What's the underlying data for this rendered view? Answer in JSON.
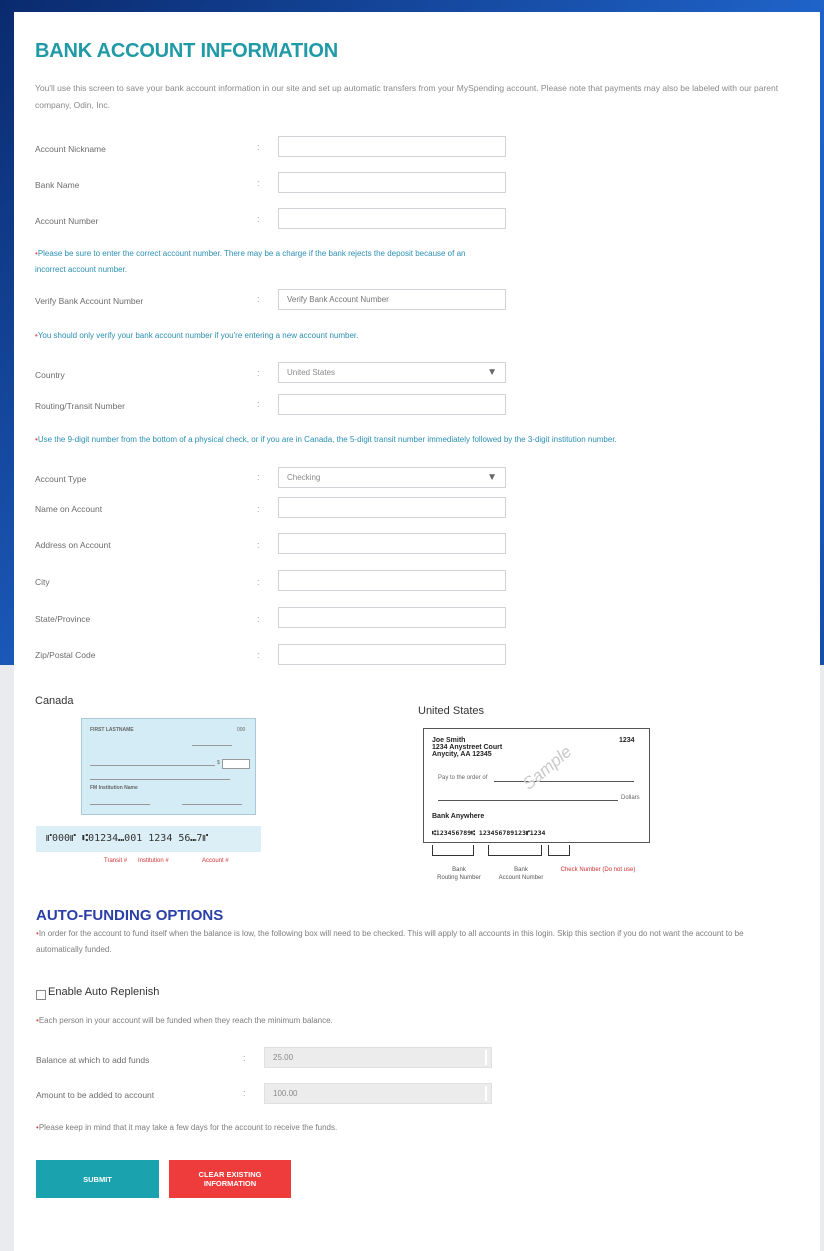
{
  "title": "BANK ACCOUNT INFORMATION",
  "intro": "You'll use this screen to save your bank account information in our site and set up automatic transfers from your MySpending account. Please note that payments may also be labeled with our parent company, Odin, Inc.",
  "colon": ":",
  "fields": {
    "nickname": {
      "label": "Account Nickname",
      "value": ""
    },
    "bank_name": {
      "label": "Bank Name",
      "value": ""
    },
    "account_number": {
      "label": "Account Number",
      "value": ""
    },
    "verify": {
      "label": "Verify Bank Account Number",
      "placeholder": "Verify Bank Account Number"
    },
    "country": {
      "label": "Country",
      "value": "United States"
    },
    "routing": {
      "label": "Routing/Transit Number",
      "value": ""
    },
    "account_type": {
      "label": "Account Type",
      "value": "Checking"
    },
    "name_on_account": {
      "label": "Name on Account",
      "value": ""
    },
    "address_on_account": {
      "label": "Address on Account",
      "value": ""
    },
    "city": {
      "label": "City",
      "value": ""
    },
    "state": {
      "label": "State/Province",
      "value": ""
    },
    "zip": {
      "label": "Zip/Postal Code",
      "value": ""
    }
  },
  "notes": {
    "account_number_line1": "Please be sure to enter the correct account number. There may be a charge if the bank rejects the deposit because of an",
    "account_number_line2": "incorrect account number.",
    "verify": "You should only verify your bank account number if you're entering a new account number.",
    "routing": "Use the 9-digit number from the bottom of a physical check, or if you are in Canada, the 5-digit transit number immediately followed by the 3-digit institution number."
  },
  "checks": {
    "canada_title": "Canada",
    "us_title": "United States",
    "canada_micr": "⑈000⑈  ⑆01234⑉001  1234 56⑉7⑈",
    "canada_labels": {
      "transit": "Transit #",
      "institution": "Institution #",
      "account": "Account #"
    },
    "us": {
      "name_line1": "Joe Smith",
      "name_line2": "1234 Anystreet Court",
      "name_line3": "Anycity, AA 12345",
      "check_no": "1234",
      "pay_to": "Pay to the order of",
      "dollars": "Dollars",
      "bank": "Bank Anywhere",
      "sample": "Sample",
      "micr": "⑆123456789⑆  123456789123⑈1234",
      "cap_routing": "Bank\nRouting Number",
      "cap_account": "Bank\nAccount Number",
      "cap_check": "Check Number (Do not use)"
    },
    "canada_small": {
      "name": "FIRST LASTNAME",
      "no": "000",
      "memo": "$",
      "inst": "FM Institution Name"
    }
  },
  "auto": {
    "title": "AUTO-FUNDING OPTIONS",
    "desc_line1": "In order for the account to fund itself when the balance is low, the following box will need to be checked. This will apply to all accounts in this login. Skip this section if you do not want the account to be",
    "desc_line2": "automatically funded.",
    "enable_label": "Enable Auto Replenish",
    "each_note": "Each person in your account will be funded when they reach the minimum balance.",
    "balance_label": "Balance at which to add funds",
    "balance_value": "25.00",
    "amount_label": "Amount to be added to account",
    "amount_value": "100.00",
    "keep_note": "Please keep in mind that it may take a few days for the account to receive the funds."
  },
  "buttons": {
    "submit": "SUBMIT",
    "clear": "CLEAR EXISTING INFORMATION"
  },
  "colors": {
    "accent": "#1f9aa6",
    "heading2": "#2b3fa8",
    "danger": "#ee3b3b",
    "note": "#2b8fb3"
  }
}
